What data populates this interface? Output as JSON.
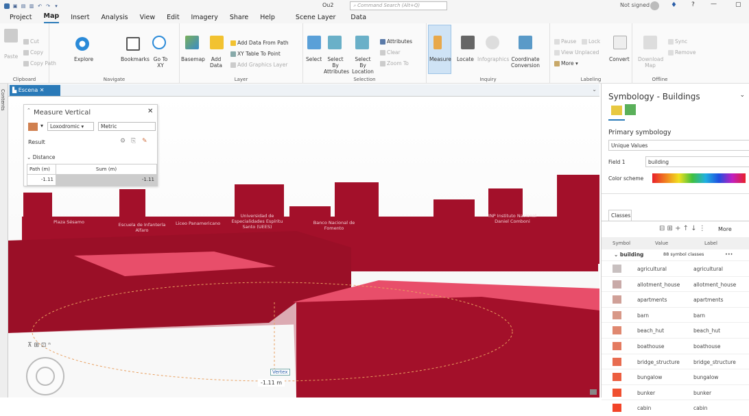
{
  "titlebar": {
    "doc_name": "Ou2",
    "search_placeholder": "Command Search (Alt+Q)",
    "user": "Not signed in",
    "help": "?",
    "minimize": "—"
  },
  "tabs": [
    "Project",
    "Map",
    "Insert",
    "Analysis",
    "View",
    "Edit",
    "Imagery",
    "Share",
    "Help",
    "Scene Layer",
    "Data"
  ],
  "ribbon": {
    "clipboard": {
      "paste": "Paste",
      "cut": "Cut",
      "copy": "Copy",
      "copy_path": "Copy Path",
      "label": "Clipboard"
    },
    "navigate": {
      "explore": "Explore",
      "bookmarks": "Bookmarks",
      "goto": "Go To XY",
      "label": "Navigate"
    },
    "layer": {
      "basemap": "Basemap",
      "add_data": "Add Data",
      "add_from_path": "Add Data From Path",
      "xy_table": "XY Table To Point",
      "add_graphics": "Add Graphics Layer",
      "label": "Layer"
    },
    "selection": {
      "select": "Select",
      "by_attr": "Select By Attributes",
      "by_loc": "Select By Location",
      "attributes": "Attributes",
      "clear": "Clear",
      "zoom_to": "Zoom To",
      "label": "Selection"
    },
    "inquiry": {
      "measure": "Measure",
      "locate": "Locate",
      "infographics": "Infographics",
      "coord": "Coordinate Conversion",
      "label": "Inquiry"
    },
    "labeling": {
      "pause": "Pause",
      "lock": "Lock",
      "view_unplaced": "View Unplaced",
      "more": "More",
      "convert": "Convert",
      "label": "Labeling"
    },
    "offline": {
      "download": "Download Map",
      "sync": "Sync",
      "remove": "Remove",
      "label": "Offline"
    }
  },
  "contents_tab": "Contents",
  "map_tab": "Escena",
  "measure": {
    "title": "Measure Vertical",
    "mode": "Loxodromic",
    "units": "Metric",
    "result_label": "Result",
    "distance_label": "Distance",
    "col_path": "Path (m)",
    "col_sum": "Sum (m)",
    "path_value": "-1.11",
    "sum_value": "-1.11"
  },
  "scene_labels": [
    "Plaza Sésamo",
    "Escuela de Infantería Alfaro",
    "Liceo Panamericano",
    "Universidad de Especialidades Espíritu Santo (UEES)",
    "Banco Nacional de Fomento",
    "INP Instituto Nacional Daniel Comboni"
  ],
  "vertex_label": "Vertex",
  "measure_readout": "-1.11 m",
  "symbology": {
    "title": "Symbology - Buildings",
    "primary_label": "Primary symbology",
    "method": "Unique Values",
    "field_label": "Field 1",
    "field_value": "building",
    "color_scheme_label": "Color scheme",
    "classes_tab": "Classes",
    "more": "More",
    "headers": [
      "Symbol",
      "Value",
      "Label"
    ],
    "group_name": "building",
    "group_count": "88 symbol classes",
    "rows": [
      {
        "value": "agricultural",
        "label": "agricultural",
        "color": "#c8c0c0"
      },
      {
        "value": "allotment_house",
        "label": "allotment_house",
        "color": "#c9aaa8"
      },
      {
        "value": "apartments",
        "label": "apartments",
        "color": "#d0a098"
      },
      {
        "value": "barn",
        "label": "barn",
        "color": "#d89888"
      },
      {
        "value": "beach_hut",
        "label": "beach_hut",
        "color": "#e08870"
      },
      {
        "value": "boathouse",
        "label": "boathouse",
        "color": "#e47a60"
      },
      {
        "value": "bridge_structure",
        "label": "bridge_structure",
        "color": "#e86c50"
      },
      {
        "value": "bungalow",
        "label": "bungalow",
        "color": "#ec5e40"
      },
      {
        "value": "bunker",
        "label": "bunker",
        "color": "#f05030"
      },
      {
        "value": "cabin",
        "label": "cabin",
        "color": "#f24428"
      }
    ]
  },
  "colors": {
    "building": "#a3102a",
    "building_top": "#e84e6a",
    "accent": "#2a7ab8"
  }
}
